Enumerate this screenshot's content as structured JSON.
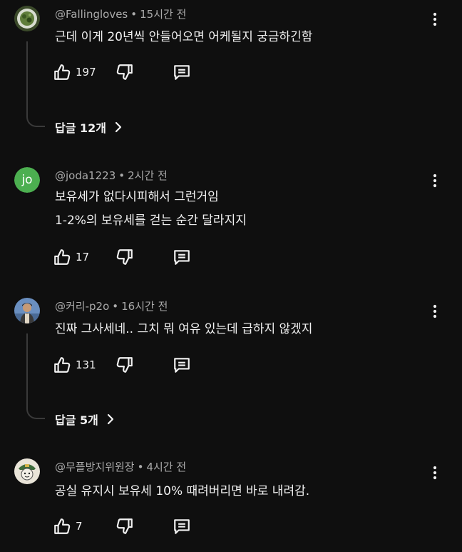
{
  "comments": [
    {
      "author": "@Fallingloves",
      "time": "15시간 전",
      "lines": [
        "근데 이게 20년씩 안들어오면 어케될지 궁금하긴함"
      ],
      "likes": "197",
      "replies": "답글 12개"
    },
    {
      "author": "@joda1223",
      "time": "2시간 전",
      "avatar_text": "jo",
      "avatar_color": "#4caf50",
      "lines": [
        "보유세가 없다시피해서 그런거임",
        "1-2%의 보유세를 걷는 순간 달라지지"
      ],
      "likes": "17"
    },
    {
      "author": "@커리-p2o",
      "time": "16시간 전",
      "lines": [
        "진짜 그사세네.. 그치 뭐 여유 있는데 급하지 않겠지"
      ],
      "likes": "131",
      "replies": "답글 5개"
    },
    {
      "author": "@무플방지위원장",
      "time": "4시간 전",
      "lines": [
        "공실 유지시 보유세 10% 때려버리면 바로 내려감."
      ],
      "likes": "7"
    }
  ],
  "separator": "•",
  "colors": {
    "background": "#0f0f0f",
    "text": "#f1f1f1",
    "meta": "#aaaaaa",
    "thread_line": "#3a3a3a"
  },
  "icons": {
    "like": "thumbs-up-icon",
    "dislike": "thumbs-down-icon",
    "reply": "comment-icon",
    "menu": "more-vertical-icon",
    "expand": "chevron-right-icon"
  }
}
